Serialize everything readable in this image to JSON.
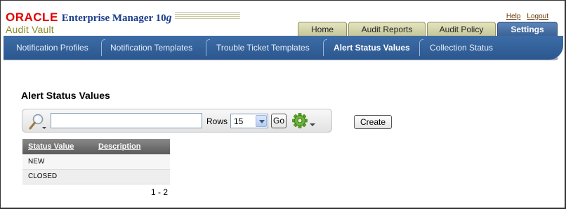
{
  "branding": {
    "oracle": "ORACLE",
    "product_line": "Enterprise Manager 10",
    "version_suffix": "g",
    "product_name": "Audit Vault"
  },
  "global_links": {
    "help": "Help",
    "logout": "Logout"
  },
  "tabs": [
    {
      "label": "Home",
      "active": false
    },
    {
      "label": "Audit Reports",
      "active": false
    },
    {
      "label": "Audit Policy",
      "active": false
    },
    {
      "label": "Settings",
      "active": true
    }
  ],
  "subnav": [
    {
      "label": "Notification Profiles",
      "active": false
    },
    {
      "label": "Notification Templates",
      "active": false
    },
    {
      "label": "Trouble Ticket Templates",
      "active": false
    },
    {
      "label": "Alert Status Values",
      "active": true
    },
    {
      "label": "Collection Status",
      "active": false
    }
  ],
  "region": {
    "title": "Alert Status Values"
  },
  "search": {
    "value": "",
    "rows_label": "Rows",
    "rows_value": "15",
    "go_label": "Go"
  },
  "actions": {
    "create_label": "Create"
  },
  "report": {
    "columns": [
      "Status Value",
      "Description"
    ],
    "rows": [
      {
        "status_value": "NEW",
        "description": ""
      },
      {
        "status_value": "CLOSED",
        "description": ""
      }
    ],
    "pagination": "1 - 2"
  },
  "colors": {
    "oracle_red": "#e00000",
    "em_blue": "#1c3e8c",
    "audit_vault_olive": "#8a8a2a",
    "tab_inactive": "#d6d6ac",
    "tab_active": "#4a72a8",
    "subnav_blue": "#2f5e99",
    "link_brown": "#663300"
  },
  "icons": {
    "search": "search-icon",
    "gear": "gear-icon",
    "dropdown": "chevron-down-icon"
  }
}
